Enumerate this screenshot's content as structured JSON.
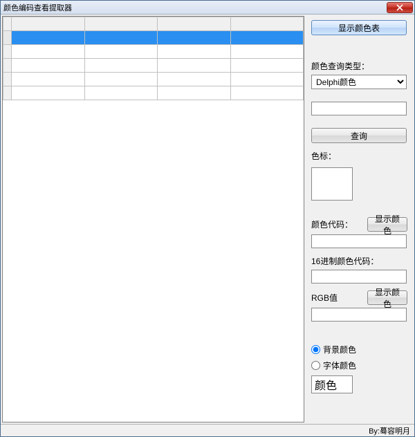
{
  "window": {
    "title": "颜色编码查看提取器"
  },
  "buttons": {
    "show_color_table": "显示颜色表",
    "query": "查询",
    "show_color_1": "显示颜色",
    "show_color_2": "显示颜色"
  },
  "labels": {
    "query_type": "颜色查询类型：",
    "swatch": "色标：",
    "color_code": "颜色代码：",
    "hex_code": "16进制颜色代码：",
    "rgb_value": "RGB值",
    "bg_color": "背景颜色",
    "font_color": "字体颜色"
  },
  "inputs": {
    "query_type_selected": "Delphi颜色",
    "query_text": "",
    "color_code": "",
    "hex_code": "",
    "rgb_value": "",
    "color_display": "颜色"
  },
  "footer": {
    "credit": "By:蓦容明月"
  },
  "grid": {
    "columns": 4,
    "rows": 5,
    "selected_row_index": 1
  }
}
